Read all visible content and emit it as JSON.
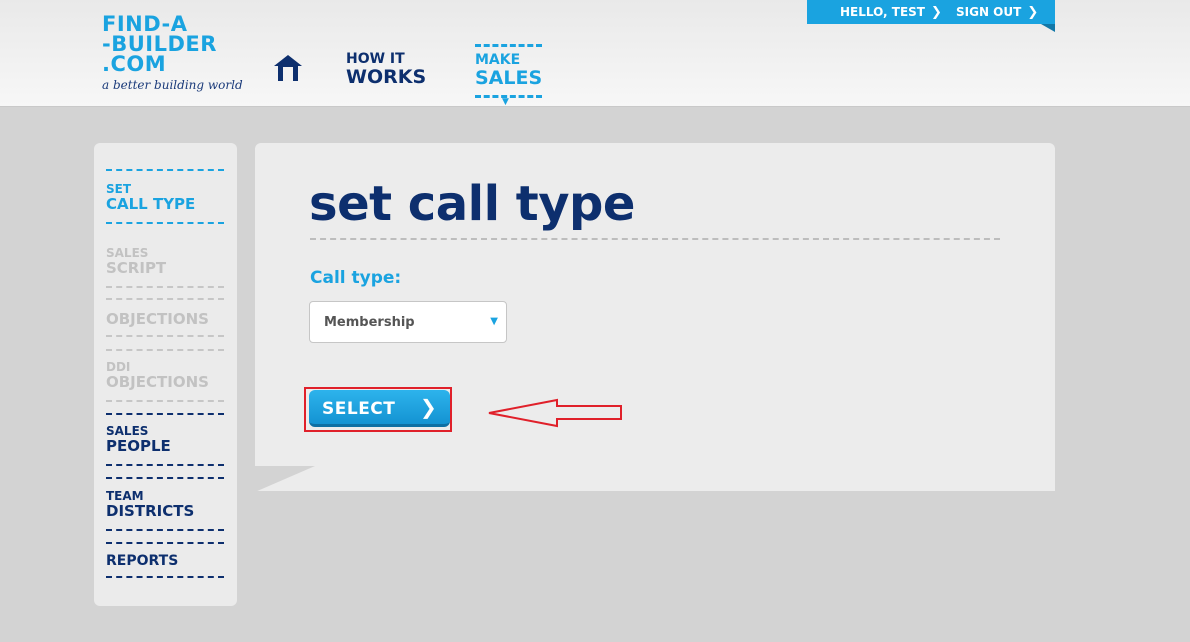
{
  "header": {
    "logo": {
      "line1": "FIND-A",
      "line2": "-BUILDER",
      "line3": ".COM",
      "tagline": "a better building world"
    },
    "nav": {
      "how": {
        "small": "HOW IT",
        "large": "WORKS"
      },
      "make": {
        "small": "MAKE",
        "large": "SALES"
      }
    },
    "topbar": {
      "hello": "HELLO, TEST",
      "signout": "SIGN OUT"
    }
  },
  "sidebar": {
    "items": [
      {
        "a": "SET",
        "b": "CALL TYPE",
        "state": "active"
      },
      {
        "a": "SALES",
        "b": "SCRIPT",
        "state": "disabled"
      },
      {
        "a": "",
        "b": "OBJECTIONS",
        "state": "disabled"
      },
      {
        "a": "DDI",
        "b": "OBJECTIONS",
        "state": "disabled"
      },
      {
        "a": "SALES",
        "b": "PEOPLE",
        "state": "enabled"
      },
      {
        "a": "TEAM",
        "b": "DISTRICTS",
        "state": "enabled"
      },
      {
        "a": "",
        "b": "REPORTS",
        "state": "enabled"
      }
    ]
  },
  "main": {
    "title": "set call type",
    "field_label": "Call type:",
    "select_value": "Membership",
    "button_label": "SELECT"
  },
  "colors": {
    "brand_blue": "#1aa3e0",
    "navy": "#0d2f6e",
    "annotation_red": "#e0202a"
  },
  "icons": [
    "home-icon",
    "chevron-right-icon",
    "dropdown-caret-icon",
    "annotation-arrow-icon"
  ]
}
